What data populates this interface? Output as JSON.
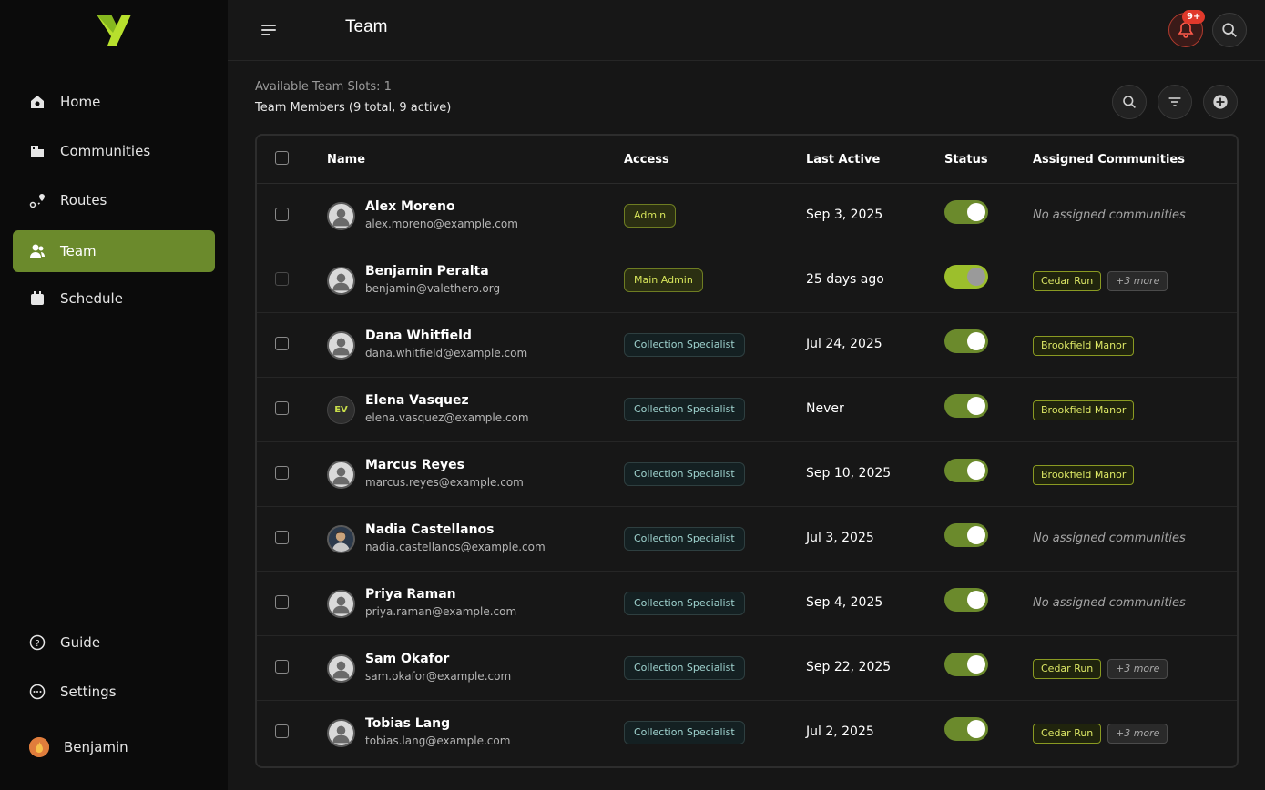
{
  "sidebar": {
    "nav": [
      {
        "label": "Home",
        "icon": "home-icon"
      },
      {
        "label": "Communities",
        "icon": "building-icon"
      },
      {
        "label": "Routes",
        "icon": "route-icon"
      },
      {
        "label": "Team",
        "icon": "team-icon",
        "active": true
      },
      {
        "label": "Schedule",
        "icon": "calendar-icon"
      }
    ],
    "bottom": [
      {
        "label": "Guide",
        "icon": "help-icon"
      },
      {
        "label": "Settings",
        "icon": "settings-icon"
      }
    ],
    "user": {
      "name": "Benjamin"
    }
  },
  "header": {
    "title": "Team",
    "notification_badge": "9+"
  },
  "summary": {
    "slots": "Available Team Slots: 1",
    "members": "Team Members (9 total, 9 active)"
  },
  "table": {
    "columns": [
      "Name",
      "Access",
      "Last Active",
      "Status",
      "Assigned Communities"
    ],
    "rows": [
      {
        "name": "Alex Moreno",
        "email": "alex.moreno@example.com",
        "access": "Admin",
        "last_active": "Sep 3, 2025",
        "status_on": true,
        "communities": "No assigned communities",
        "more": ""
      },
      {
        "name": "Benjamin Peralta",
        "email": "benjamin@valethero.org",
        "access": "Main Admin",
        "last_active": "25 days ago",
        "status_on": true,
        "communities": "Cedar Run",
        "more": "+3 more"
      },
      {
        "name": "Dana Whitfield",
        "email": "dana.whitfield@example.com",
        "access": "Collection Specialist",
        "last_active": "Jul 24, 2025",
        "status_on": true,
        "communities": "Brookfield Manor",
        "more": ""
      },
      {
        "name": "Elena Vasquez",
        "email": "elena.vasquez@example.com",
        "access": "Collection Specialist",
        "last_active": "Never",
        "status_on": true,
        "communities": "Brookfield Manor",
        "more": "",
        "initials": "EV"
      },
      {
        "name": "Marcus Reyes",
        "email": "marcus.reyes@example.com",
        "access": "Collection Specialist",
        "last_active": "Sep 10, 2025",
        "status_on": true,
        "communities": "Brookfield Manor",
        "more": ""
      },
      {
        "name": "Nadia Castellanos",
        "email": "nadia.castellanos@example.com",
        "access": "Collection Specialist",
        "last_active": "Jul 3, 2025",
        "status_on": true,
        "communities": "No assigned communities",
        "more": ""
      },
      {
        "name": "Priya Raman",
        "email": "priya.raman@example.com",
        "access": "Collection Specialist",
        "last_active": "Sep 4, 2025",
        "status_on": true,
        "communities": "No assigned communities",
        "more": ""
      },
      {
        "name": "Sam Okafor",
        "email": "sam.okafor@example.com",
        "access": "Collection Specialist",
        "last_active": "Sep 22, 2025",
        "status_on": true,
        "communities": "Cedar Run",
        "more": "+3 more"
      },
      {
        "name": "Tobias Lang",
        "email": "tobias.lang@example.com",
        "access": "Collection Specialist",
        "last_active": "Jul 2, 2025",
        "status_on": true,
        "communities": "Cedar Run",
        "more": "+3 more"
      }
    ]
  },
  "colors": {
    "accent": "#6b8a2c",
    "badge": "#e0392b",
    "tag_text": "#dce765"
  }
}
